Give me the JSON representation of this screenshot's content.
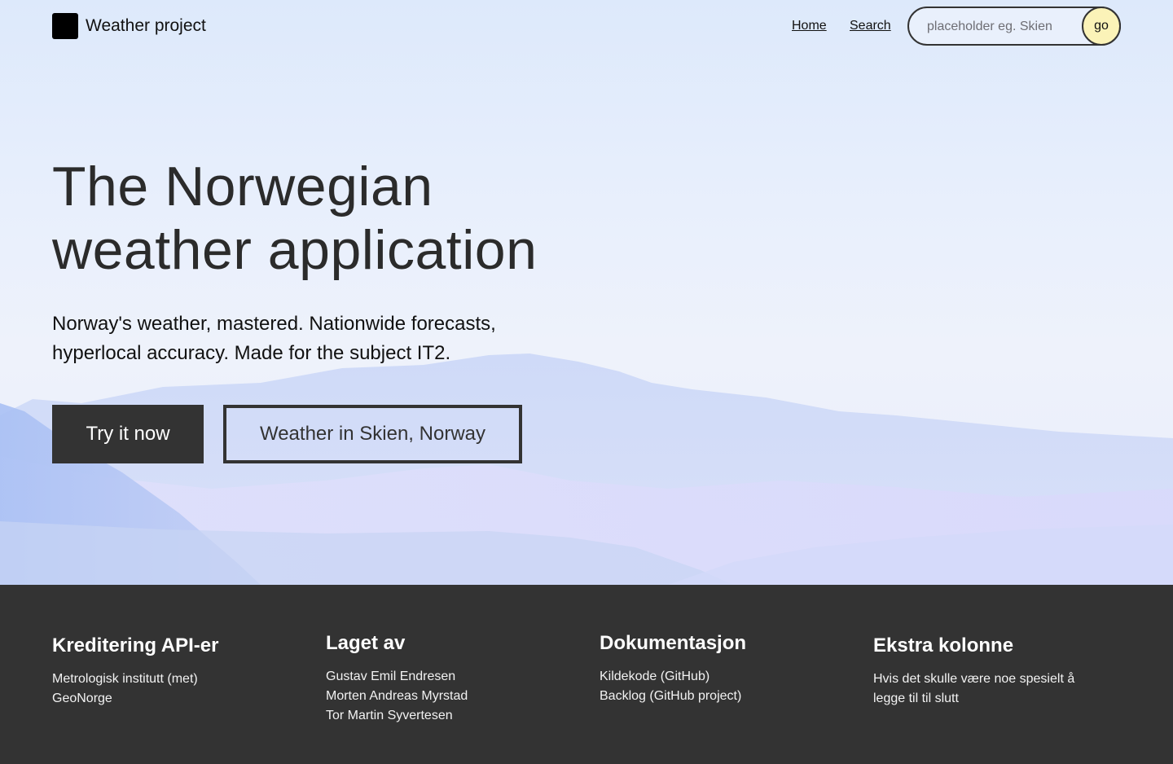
{
  "header": {
    "brand": "Weather project",
    "nav": {
      "home": "Home",
      "search": "Search"
    },
    "search": {
      "placeholder": "placeholder eg. Skien",
      "button": "go"
    }
  },
  "hero": {
    "title_line1": "The Norwegian",
    "title_line2": "weather application",
    "subtitle_line1": "Norway's weather, mastered. Nationwide forecasts,",
    "subtitle_line2": "hyperlocal accuracy. Made for the subject IT2.",
    "primary_button": "Try it now",
    "secondary_button": "Weather in Skien, Norway"
  },
  "footer": {
    "columns": [
      {
        "heading": "Kreditering API-er",
        "items": [
          "Metrologisk institutt (met)",
          "GeoNorge"
        ]
      },
      {
        "heading": "Laget av",
        "items": [
          "Gustav Emil Endresen",
          "Morten Andreas Myrstad",
          "Tor Martin Syvertesen"
        ]
      },
      {
        "heading": "Dokumentasjon",
        "items": [
          "Kildekode (GitHub)",
          "Backlog (GitHub project)"
        ]
      },
      {
        "heading": "Ekstra kolonne",
        "items": [
          "Hvis det skulle være noe spesielt å",
          "legge til til slutt"
        ]
      }
    ]
  },
  "colors": {
    "dark": "#333333",
    "go_button": "#fbf3b8",
    "hero_background": "#e8effc"
  }
}
